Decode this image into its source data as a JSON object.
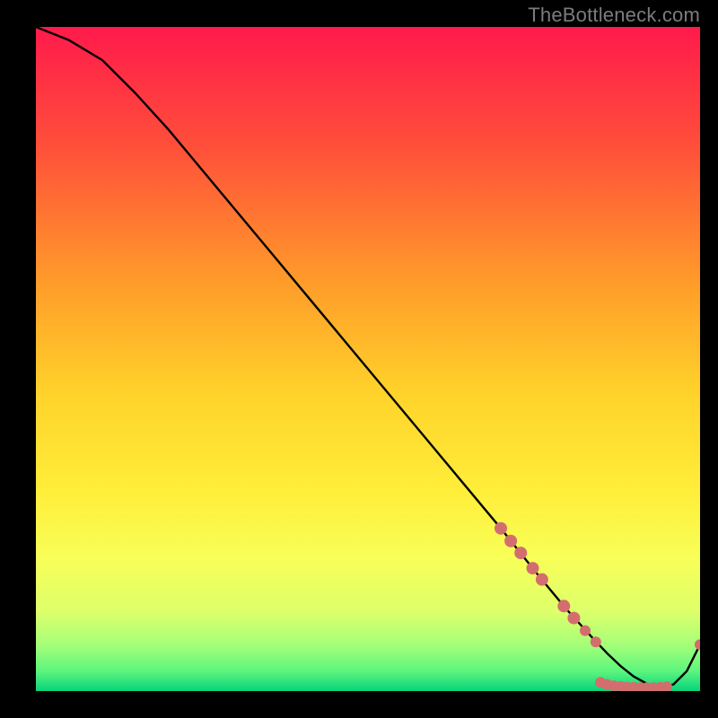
{
  "watermark": "TheBottleneck.com",
  "colors": {
    "background": "#000000",
    "gradient_top": "#ff1a4b",
    "gradient_mid_upper": "#ff8a2a",
    "gradient_mid": "#ffe22e",
    "gradient_mid_lower": "#f6ff60",
    "gradient_low": "#9dff7a",
    "gradient_bottom": "#07e07d",
    "curve": "#000000",
    "dot": "#d36e6e"
  },
  "chart_data": {
    "type": "line",
    "title": "",
    "xlabel": "",
    "ylabel": "",
    "xlim": [
      0,
      100
    ],
    "ylim": [
      0,
      100
    ],
    "grid": false,
    "legend": false,
    "x": [
      0,
      5,
      10,
      15,
      20,
      25,
      30,
      35,
      40,
      45,
      50,
      55,
      60,
      65,
      70,
      72,
      74,
      76,
      78,
      80,
      82,
      84,
      86,
      88,
      90,
      92,
      94,
      96,
      98,
      100
    ],
    "values": [
      100,
      98,
      95,
      90,
      84.5,
      78.5,
      72.5,
      66.5,
      60.5,
      54.5,
      48.5,
      42.5,
      36.5,
      30.5,
      24.5,
      22,
      19.5,
      17,
      14.6,
      12.2,
      10,
      7.8,
      5.7,
      3.8,
      2.2,
      1.1,
      0.5,
      1.0,
      3.0,
      7.0
    ],
    "series": [
      {
        "name": "curve",
        "type": "line",
        "x": [
          0,
          5,
          10,
          15,
          20,
          25,
          30,
          35,
          40,
          45,
          50,
          55,
          60,
          65,
          70,
          72,
          74,
          76,
          78,
          80,
          82,
          84,
          86,
          88,
          90,
          92,
          94,
          96,
          98,
          100
        ],
        "values": [
          100,
          98,
          95,
          90,
          84.5,
          78.5,
          72.5,
          66.5,
          60.5,
          54.5,
          48.5,
          42.5,
          36.5,
          30.5,
          24.5,
          22,
          19.5,
          17,
          14.6,
          12.2,
          10,
          7.8,
          5.7,
          3.8,
          2.2,
          1.1,
          0.5,
          1.0,
          3.0,
          7.0
        ]
      },
      {
        "name": "dots",
        "type": "scatter",
        "points": [
          {
            "x": 70.0,
            "y": 24.5,
            "r": 6.5
          },
          {
            "x": 71.5,
            "y": 22.6,
            "r": 6.5
          },
          {
            "x": 73.0,
            "y": 20.8,
            "r": 6.5
          },
          {
            "x": 74.8,
            "y": 18.5,
            "r": 6.5
          },
          {
            "x": 76.2,
            "y": 16.8,
            "r": 6.5
          },
          {
            "x": 79.5,
            "y": 12.8,
            "r": 6.5
          },
          {
            "x": 81.0,
            "y": 11.0,
            "r": 6.5
          },
          {
            "x": 82.7,
            "y": 9.1,
            "r": 5.5
          },
          {
            "x": 84.3,
            "y": 7.4,
            "r": 5.5
          },
          {
            "x": 85.0,
            "y": 1.3,
            "r": 5.5
          },
          {
            "x": 86.0,
            "y": 1.0,
            "r": 5.5
          },
          {
            "x": 87.0,
            "y": 0.8,
            "r": 5.5
          },
          {
            "x": 88.0,
            "y": 0.7,
            "r": 5.5
          },
          {
            "x": 89.0,
            "y": 0.6,
            "r": 5.5
          },
          {
            "x": 90.0,
            "y": 0.55,
            "r": 5.5
          },
          {
            "x": 91.0,
            "y": 0.5,
            "r": 5.5
          },
          {
            "x": 92.0,
            "y": 0.5,
            "r": 5.5
          },
          {
            "x": 93.0,
            "y": 0.5,
            "r": 5.5
          },
          {
            "x": 94.0,
            "y": 0.55,
            "r": 5.5
          },
          {
            "x": 95.0,
            "y": 0.65,
            "r": 5.5
          },
          {
            "x": 100.0,
            "y": 7.0,
            "r": 5.5
          }
        ]
      }
    ]
  }
}
